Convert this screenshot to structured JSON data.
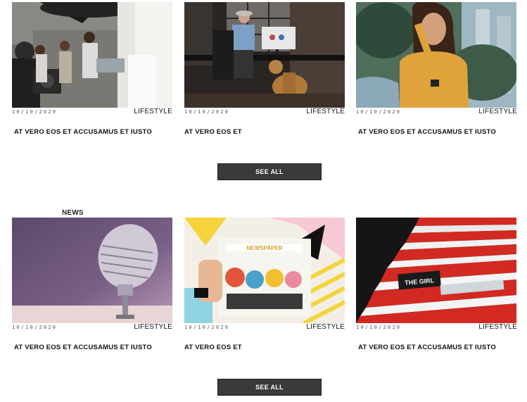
{
  "sections": [
    {
      "heading": "",
      "cards": [
        {
          "date": "10/10/2020",
          "category": "LIFESTYLE",
          "title": "AT VERO EOS ET ACCUSAMUS ET IUSTO"
        },
        {
          "date": "10/10/2020",
          "category": "LIFESTYLE",
          "title": "AT VERO EOS ET"
        },
        {
          "date": "10/10/2020",
          "category": "LIFESTYLE",
          "title": "AT VERO EOS ET ACCUSAMUS ET IUSTO"
        }
      ],
      "see_all_label": "SEE ALL"
    },
    {
      "heading": "NEWS",
      "cards": [
        {
          "date": "10/10/2020",
          "category": "LIFESTYLE",
          "title": "AT VERO EOS ET ACCUSAMUS ET IUSTO"
        },
        {
          "date": "10/10/2020",
          "category": "LIFESTYLE",
          "title": "AT VERO EOS ET"
        },
        {
          "date": "10/10/2020",
          "category": "LIFESTYLE",
          "title": "AT VERO EOS ET ACCUSAMUS ET IUSTO"
        }
      ],
      "see_all_label": "SEE ALL"
    }
  ],
  "images": {
    "newspaper_masthead": "NEWSPAPER",
    "magazine_cover_text": "THE GIRL"
  },
  "colors": {
    "button_bg": "#3a3a3a",
    "text": "#111111",
    "muted": "#555555"
  }
}
